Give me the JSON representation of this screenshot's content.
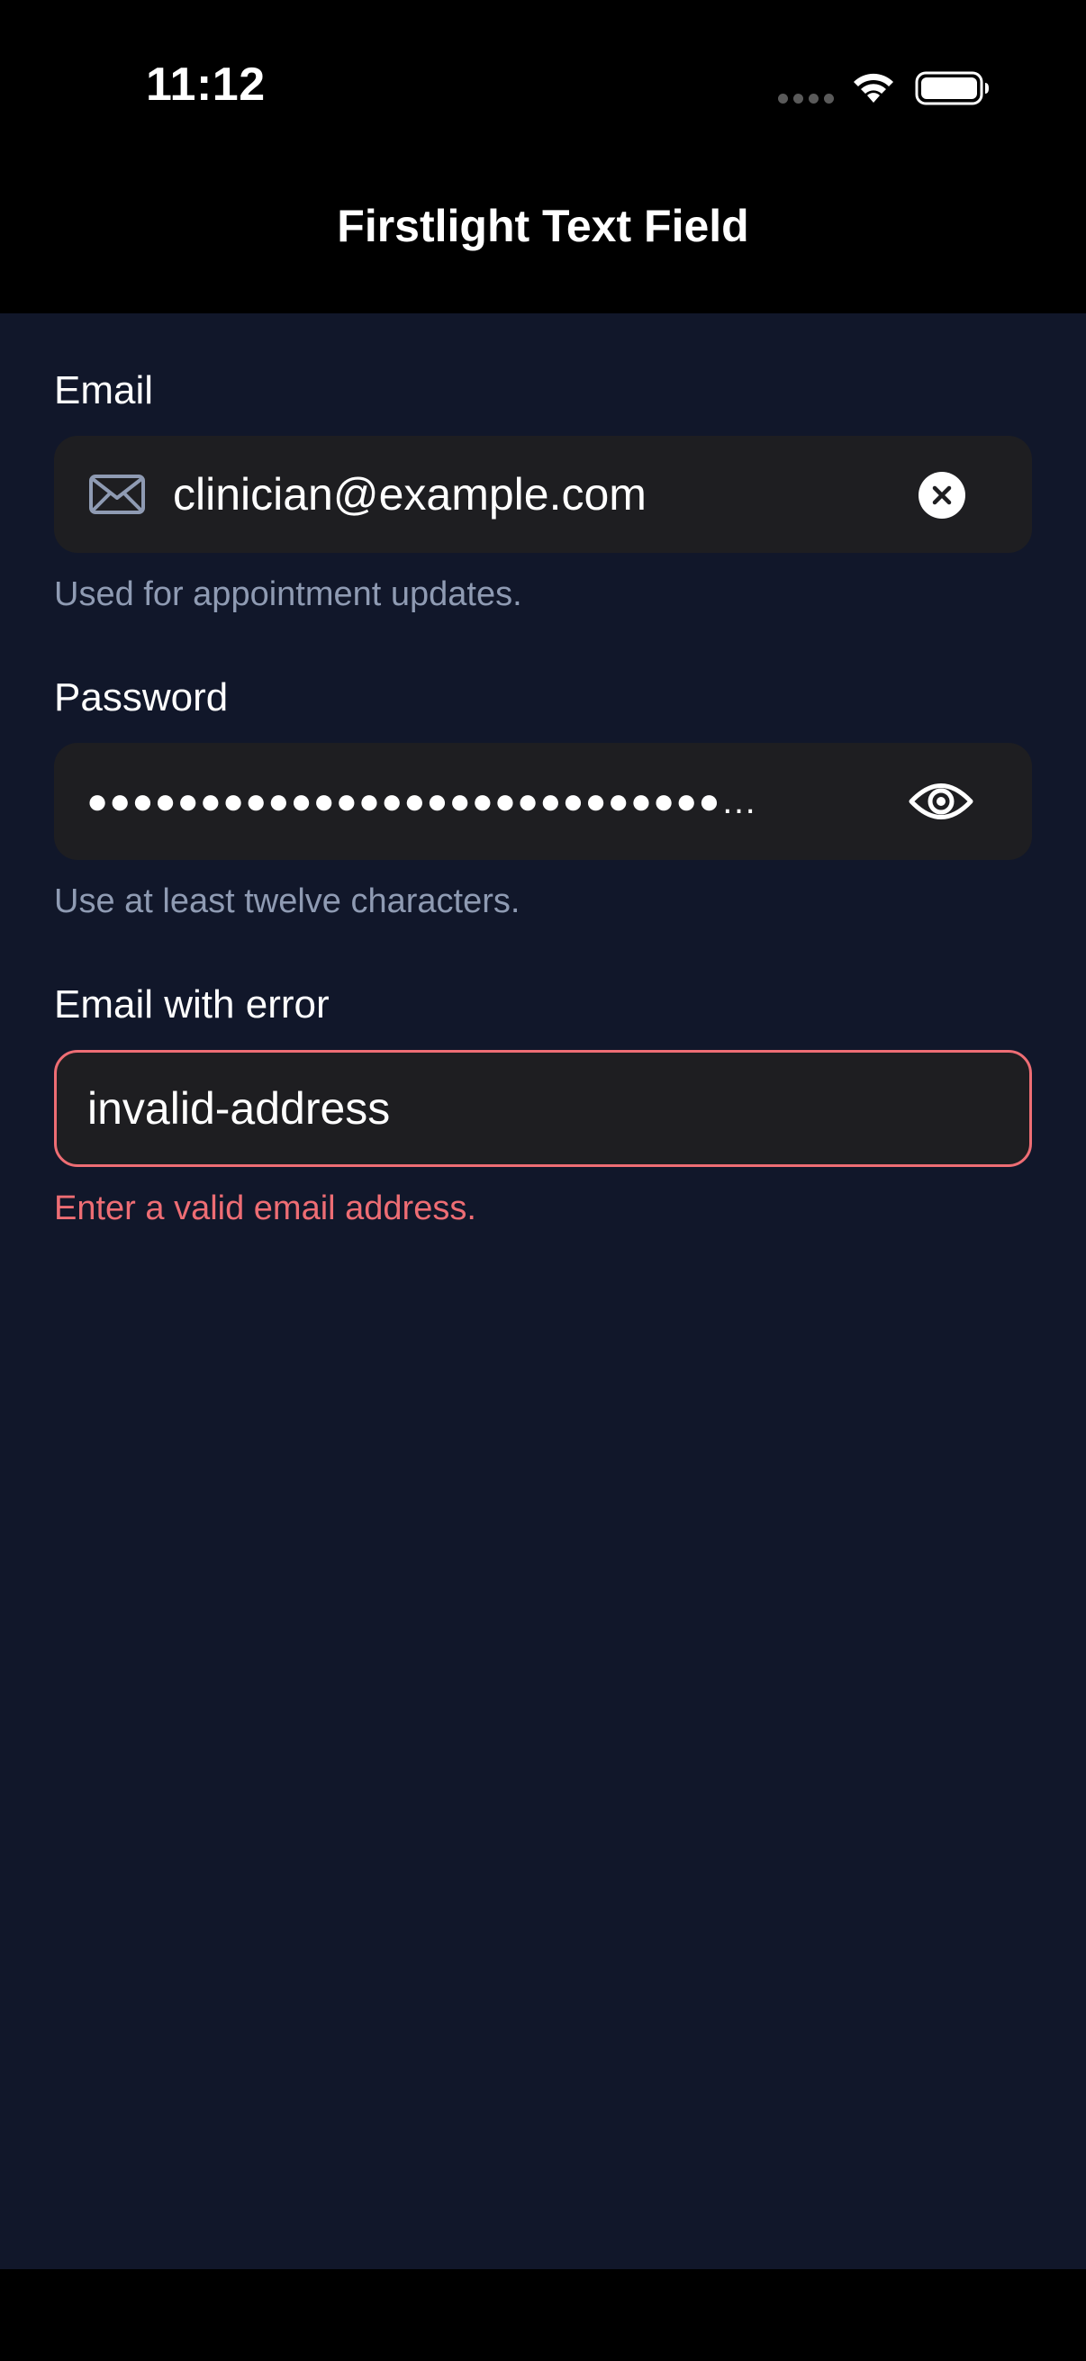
{
  "status_bar": {
    "time": "11:12"
  },
  "nav": {
    "title": "Firstlight Text Field"
  },
  "fields": {
    "email": {
      "label": "Email",
      "value": "clinician@example.com",
      "help": "Used for appointment updates.",
      "leading_icon": "envelope-icon",
      "trailing_icon": "clear-circle-icon"
    },
    "password": {
      "label": "Password",
      "value": "●●●●●●●●●●●●●●●●●●●●●●●●●●●●…",
      "help": "Use at least twelve characters.",
      "trailing_icon": "eye-icon"
    },
    "email_error": {
      "label": "Email with error",
      "value": "invalid-address",
      "help": "Enter a valid email address."
    }
  },
  "colors": {
    "background": "#11172a",
    "field": "#1e1e21",
    "error": "#ee6d74",
    "help_text": "#8f9bb3"
  }
}
